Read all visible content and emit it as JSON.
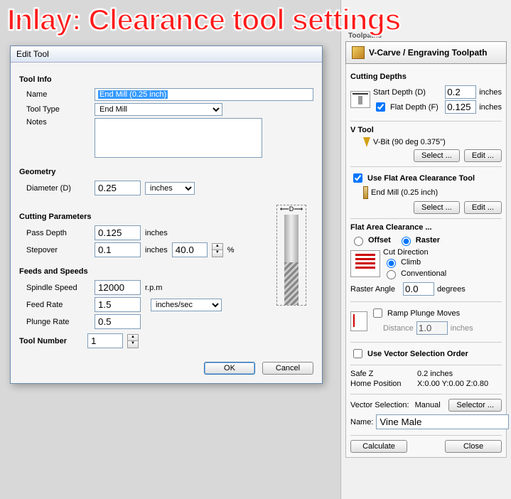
{
  "overlay": "Inlay: Clearance tool settings",
  "dialog": {
    "title": "Edit Tool",
    "tool_info_label": "Tool Info",
    "name_label": "Name",
    "name_value": "End Mill (0.25 inch)",
    "tooltype_label": "Tool Type",
    "tooltype_value": "End Mill",
    "notes_label": "Notes",
    "notes_value": "",
    "geometry_label": "Geometry",
    "diameter_label": "Diameter (D)",
    "diameter_value": "0.25",
    "diameter_unit": "inches",
    "cutting_label": "Cutting Parameters",
    "passdepth_label": "Pass Depth",
    "passdepth_value": "0.125",
    "passdepth_unit": "inches",
    "stepover_label": "Stepover",
    "stepover_value": "0.1",
    "stepover_unit": "inches",
    "stepover_pct": "40.0",
    "pct_symbol": "%",
    "feeds_label": "Feeds and Speeds",
    "spindle_label": "Spindle Speed",
    "spindle_value": "12000",
    "spindle_unit": "r.p.m",
    "feedrate_label": "Feed Rate",
    "feedrate_value": "1.5",
    "plungerate_label": "Plunge Rate",
    "plungerate_value": "0.5",
    "feed_unit": "inches/sec",
    "toolnum_label": "Tool Number",
    "toolnum_value": "1",
    "ok": "OK",
    "cancel": "Cancel",
    "d_marker": "D"
  },
  "panel": {
    "tab": "Toolpaths",
    "header": "V-Carve / Engraving Toolpath",
    "depths_label": "Cutting Depths",
    "start_depth_label": "Start Depth (D)",
    "start_depth_value": "0.2",
    "flat_depth_label": "Flat Depth (F)",
    "flat_depth_value": "0.125",
    "unit": "inches",
    "vtool_label": "V Tool",
    "vtool_name": "V-Bit (90 deg 0.375\")",
    "select": "Select ...",
    "edit": "Edit ...",
    "usefatc_label": "Use Flat Area Clearance Tool",
    "fatc_tool": "End Mill (0.25 inch)",
    "fac_header": "Flat Area Clearance ...",
    "offset": "Offset",
    "raster": "Raster",
    "cutdir_label": "Cut Direction",
    "climb": "Climb",
    "conventional": "Conventional",
    "raster_angle_label": "Raster Angle",
    "raster_angle_value": "0.0",
    "degrees": "degrees",
    "ramp_label": "Ramp Plunge Moves",
    "distance_label": "Distance",
    "distance_value": "1.0",
    "use_vso_label": "Use Vector Selection Order",
    "safez_label": "Safe Z",
    "safez_value": "0.2 inches",
    "home_label": "Home Position",
    "home_value": "X:0.00 Y:0.00 Z:0.80",
    "vecsel_label": "Vector Selection:",
    "vecsel_value": "Manual",
    "selector": "Selector ...",
    "name_label": "Name:",
    "name_value": "Vine Male",
    "calculate": "Calculate",
    "close": "Close"
  }
}
